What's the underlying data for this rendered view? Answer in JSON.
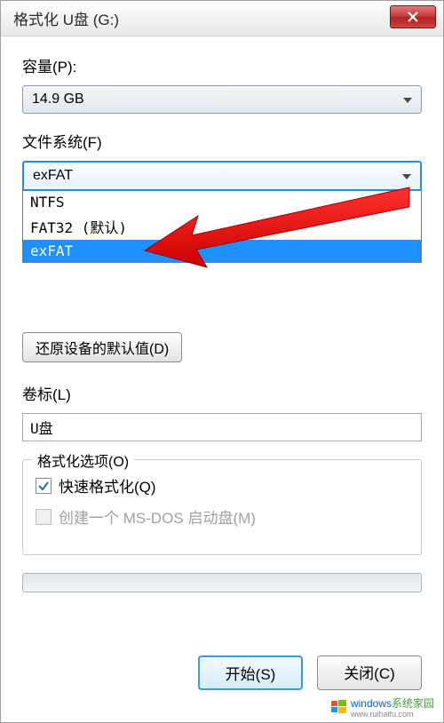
{
  "titlebar": {
    "title": "格式化 U盘 (G:)"
  },
  "capacity": {
    "label": "容量(P):",
    "value": "14.9 GB"
  },
  "filesystem": {
    "label": "文件系统(F)",
    "selected": "exFAT",
    "options": [
      {
        "text": "NTFS",
        "selected": false
      },
      {
        "text": "FAT32 (默认)",
        "selected": false
      },
      {
        "text": "exFAT",
        "selected": true
      }
    ]
  },
  "restore_defaults": {
    "label": "还原设备的默认值(D)"
  },
  "volume_label": {
    "label": "卷标(L)",
    "value": "U盘"
  },
  "format_options": {
    "legend": "格式化选项(O)",
    "quick_format": {
      "label": "快速格式化(Q)",
      "checked": true
    },
    "msdos_boot": {
      "label": "创建一个 MS-DOS 启动盘(M)",
      "checked": false,
      "disabled": true
    }
  },
  "buttons": {
    "start": "开始(S)",
    "close": "关闭(C)"
  },
  "watermark": {
    "brand_en": "windows",
    "brand_cn": "系统家园",
    "url": "www.ruihaifu.com"
  }
}
